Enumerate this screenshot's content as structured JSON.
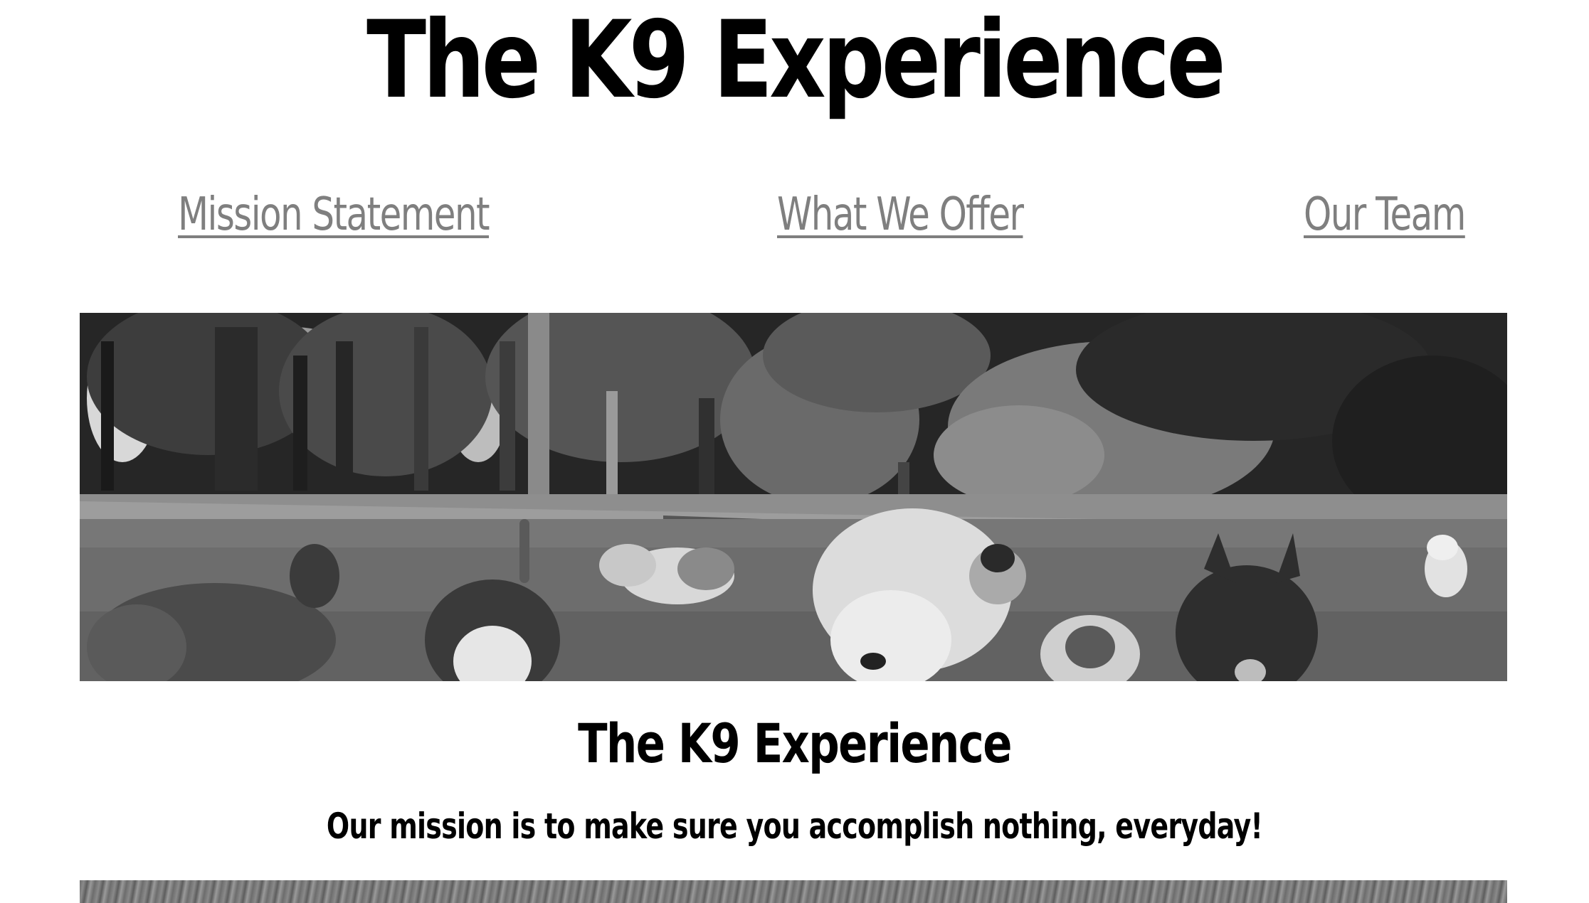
{
  "header": {
    "title": "The K9 Experience"
  },
  "nav": {
    "items": [
      {
        "label": "Mission Statement"
      },
      {
        "label": "What We Offer"
      },
      {
        "label": "Our Team"
      }
    ],
    "link_color": "#7f7f7f"
  },
  "hero": {
    "image_description_icon": "dogs-in-park-photo"
  },
  "main": {
    "section_title": "The K9 Experience",
    "mission_text": "Our mission is to make sure you accomplish nothing, everyday!"
  },
  "colors": {
    "background": "#ffffff",
    "text": "#000000",
    "link": "#7f7f7f"
  }
}
